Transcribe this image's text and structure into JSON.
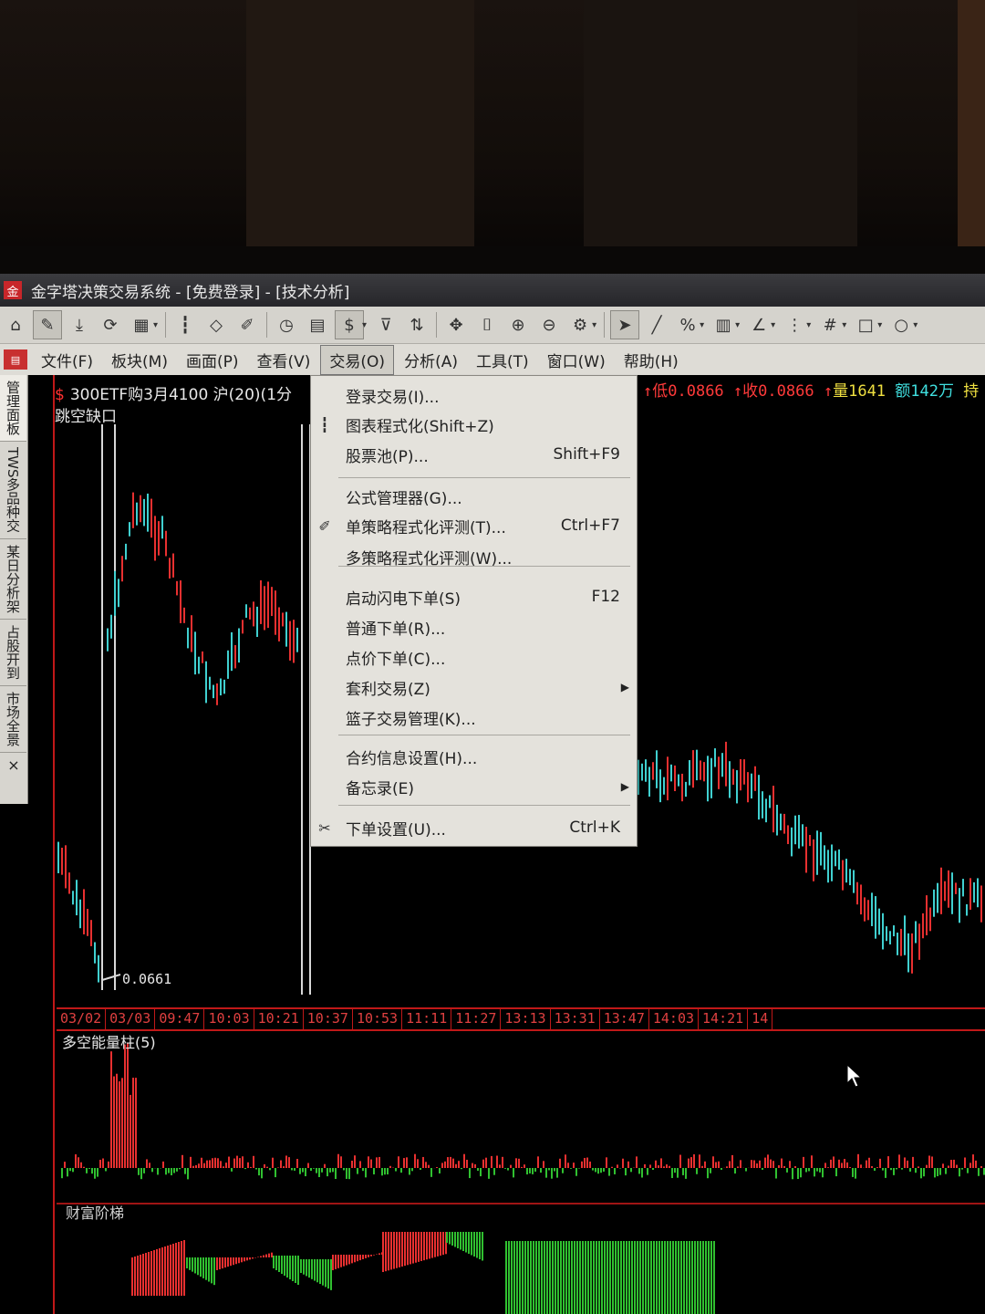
{
  "window": {
    "title": "金字塔决策交易系统 - [免费登录] - [技术分析]",
    "app_icon": "金"
  },
  "toolbar": {
    "buttons": [
      {
        "icon": "home-icon",
        "glyph": "⌂"
      },
      {
        "icon": "pencil-icon",
        "glyph": "✎",
        "pressed": true
      },
      {
        "icon": "download-icon",
        "glyph": "⤓"
      },
      {
        "icon": "refresh-icon",
        "glyph": "⟳"
      },
      {
        "icon": "grid-icon",
        "glyph": "▦"
      },
      {
        "icon": "candlestick-icon",
        "glyph": "┇"
      },
      {
        "icon": "diamond-icon",
        "glyph": "◇"
      },
      {
        "icon": "edit-icon",
        "glyph": "✐"
      },
      {
        "icon": "clock-icon",
        "glyph": "◷"
      },
      {
        "icon": "document-icon",
        "glyph": "▤"
      },
      {
        "icon": "dollar-icon",
        "glyph": "$",
        "pressed": true
      },
      {
        "icon": "filter-icon",
        "glyph": "⊽"
      },
      {
        "icon": "chart-switch-icon",
        "glyph": "⇅"
      },
      {
        "icon": "move-icon",
        "glyph": "✥"
      },
      {
        "icon": "bracket-icon",
        "glyph": "⌷"
      },
      {
        "icon": "zoom-in-icon",
        "glyph": "⊕"
      },
      {
        "icon": "zoom-out-icon",
        "glyph": "⊖"
      },
      {
        "icon": "settings-icon",
        "glyph": "⚙"
      },
      {
        "icon": "pointer-icon",
        "glyph": "➤",
        "pressed": true
      },
      {
        "icon": "line-tool-icon",
        "glyph": "╱"
      },
      {
        "icon": "percent-icon",
        "glyph": "%"
      },
      {
        "icon": "ruler-icon",
        "glyph": "▥"
      },
      {
        "icon": "angle-icon",
        "glyph": "∠"
      },
      {
        "icon": "level-icon",
        "glyph": "⋮"
      },
      {
        "icon": "hash-icon",
        "glyph": "#"
      },
      {
        "icon": "rectangle-icon",
        "glyph": "□"
      },
      {
        "icon": "circle-icon",
        "glyph": "○"
      }
    ]
  },
  "menubar": {
    "items": [
      "文件(F)",
      "板块(M)",
      "画面(P)",
      "查看(V)",
      "交易(O)",
      "分析(A)",
      "工具(T)",
      "窗口(W)",
      "帮助(H)"
    ],
    "active": "交易(O)"
  },
  "sidebar": {
    "tabs": [
      "管理面板",
      "TWS多品种交",
      "某日分析架",
      "占股开到",
      "市场全景"
    ],
    "close": "×"
  },
  "chart": {
    "header_left": "300ETF购3月4100 沪(20)(1分",
    "header_symbol_icon": "$",
    "subtitle": "跳空缺口",
    "header_right": {
      "low": "低0.0866",
      "close": "收0.0866",
      "volume": "量1641",
      "amount": "额142万",
      "hold": "持"
    },
    "price_label": "0.0661",
    "time_ticks": [
      "03/02",
      "03/03",
      "09:47",
      "10:03",
      "10:21",
      "10:37",
      "10:53",
      "11:11",
      "11:27",
      "13:13",
      "13:31",
      "13:47",
      "14:03",
      "14:21",
      "14"
    ],
    "indicator1_title": "多空能量柱(5)",
    "indicator2_title": "财富阶梯",
    "colors": {
      "up": "#e83030",
      "down": "#40d0d0",
      "axis": "#c01818",
      "grid": "#a01414"
    }
  },
  "trade_menu": {
    "items": [
      {
        "label": "登录交易(I)...",
        "shortcut": "",
        "icon": "",
        "submenu": false
      },
      {
        "label": "图表程式化(Shift+Z)",
        "shortcut": "",
        "icon": "candlestick-icon",
        "submenu": false
      },
      {
        "label": "股票池(P)...",
        "shortcut": "Shift+F9",
        "icon": "",
        "submenu": false
      },
      {
        "label": "公式管理器(G)...",
        "shortcut": "",
        "icon": "",
        "submenu": false
      },
      {
        "label": "单策略程式化评测(T)...",
        "shortcut": "Ctrl+F7",
        "icon": "edit-icon",
        "submenu": false
      },
      {
        "label": "多策略程式化评测(W)...",
        "shortcut": "",
        "icon": "",
        "submenu": false
      },
      {
        "label": "启动闪电下单(S)",
        "shortcut": "F12",
        "icon": "",
        "submenu": false
      },
      {
        "label": "普通下单(R)...",
        "shortcut": "",
        "icon": "",
        "submenu": false
      },
      {
        "label": "点价下单(C)...",
        "shortcut": "",
        "icon": "",
        "submenu": false
      },
      {
        "label": "套利交易(Z)",
        "shortcut": "",
        "icon": "",
        "submenu": true
      },
      {
        "label": "篮子交易管理(K)...",
        "shortcut": "",
        "icon": "",
        "submenu": false
      },
      {
        "label": "合约信息设置(H)...",
        "shortcut": "",
        "icon": "",
        "submenu": false
      },
      {
        "label": "备忘录(E)",
        "shortcut": "",
        "icon": "",
        "submenu": true
      },
      {
        "label": "下单设置(U)...",
        "shortcut": "Ctrl+K",
        "icon": "tools-icon",
        "submenu": false
      }
    ]
  }
}
